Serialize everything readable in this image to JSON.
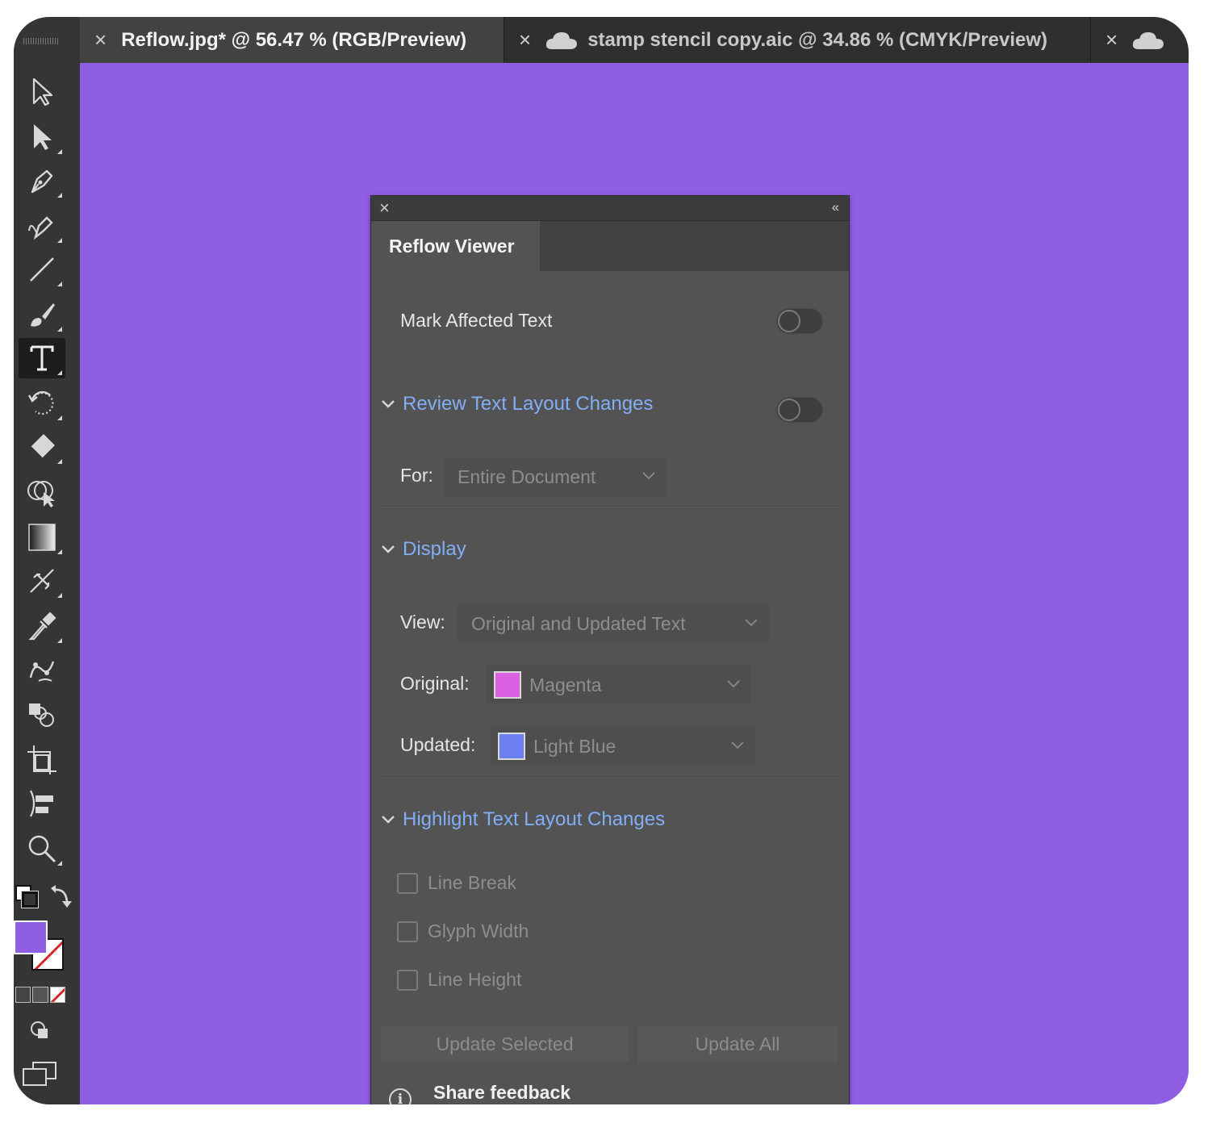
{
  "tabs": [
    {
      "label": "Reflow.jpg* @ 56.47 % (RGB/Preview)",
      "close": "×",
      "active": true
    },
    {
      "label": "stamp stencil copy.aic @ 34.86 % (CMYK/Preview)",
      "close": "×",
      "active": false
    },
    {
      "label": "",
      "close": "×",
      "active": false
    }
  ],
  "colors": {
    "canvas": "#8f5ee3",
    "accent_text": "#82aef5",
    "fill_swatch": "#8f5ee3",
    "original_swatch": "#d862e2",
    "updated_swatch": "#6b7ff0"
  },
  "toolbar": {
    "tools": [
      "selection-icon",
      "direct-selection-icon",
      "pen-icon",
      "curvature-icon",
      "line-segment-icon",
      "paintbrush-icon",
      "type-icon",
      "rotate-icon",
      "eraser-icon",
      "shape-builder-icon",
      "gradient-icon",
      "width-tool-icon",
      "eyedropper-icon",
      "puppet-warp-icon",
      "blend-icon",
      "artboard-icon",
      "align-icon",
      "zoom-icon"
    ],
    "active_tool": "type-icon"
  },
  "panel": {
    "close": "×",
    "collapse": "‹‹",
    "tab_label": "Reflow Viewer",
    "mark_affected_label": "Mark Affected Text",
    "mark_affected_on": false,
    "review_section": "Review Text Layout Changes",
    "review_on": false,
    "for_label": "For:",
    "for_value": "Entire Document",
    "display_section": "Display",
    "view_label": "View:",
    "view_value": "Original and Updated Text",
    "original_label": "Original:",
    "original_value": "Magenta",
    "updated_label": "Updated:",
    "updated_value": "Light Blue",
    "highlight_section": "Highlight Text Layout Changes",
    "checkboxes": [
      {
        "label": "Line Break",
        "checked": false
      },
      {
        "label": "Glyph Width",
        "checked": false
      },
      {
        "label": "Line Height",
        "checked": false
      }
    ],
    "update_selected": "Update Selected",
    "update_all": "Update All",
    "info_glyph": "i",
    "share_feedback": "Share feedback"
  }
}
